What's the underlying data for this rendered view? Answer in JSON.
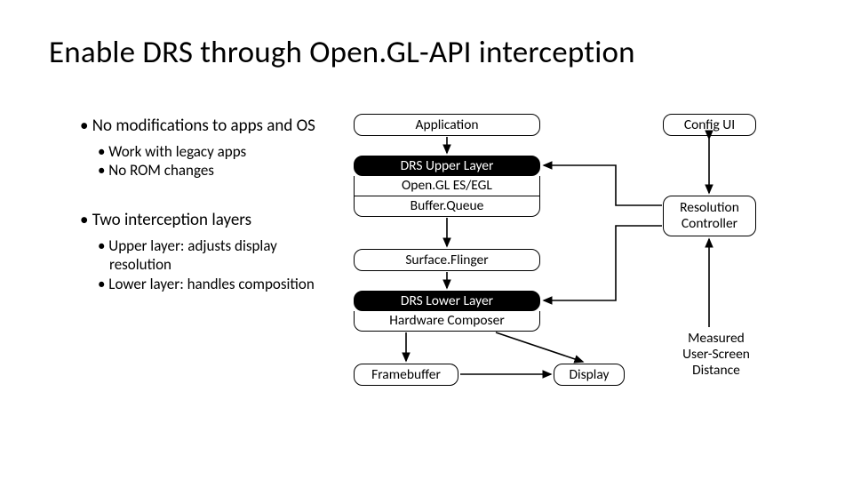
{
  "title": "Enable DRS through Open.GL-API interception",
  "bullets": {
    "p1": "• No modifications to apps and OS",
    "p1a": "• Work with legacy apps",
    "p1b": "• No ROM changes",
    "p2": "• Two interception layers",
    "p2a": "• Upper layer: adjusts display resolution",
    "p2b": "• Lower layer: handles composition"
  },
  "diagram": {
    "application": "Application",
    "drs_upper": "DRS Upper Layer",
    "opengl": "Open.GL ES/EGL",
    "bufferq": "Buffer.Queue",
    "surfacef": "Surface.Flinger",
    "drs_lower": "DRS Lower Layer",
    "hwc": "Hardware Composer",
    "framebuffer": "Framebuffer",
    "display": "Display",
    "config_ui": "Config UI",
    "res_ctrl": "Resolution\nController",
    "measured": "Measured\nUser-Screen\nDistance"
  }
}
